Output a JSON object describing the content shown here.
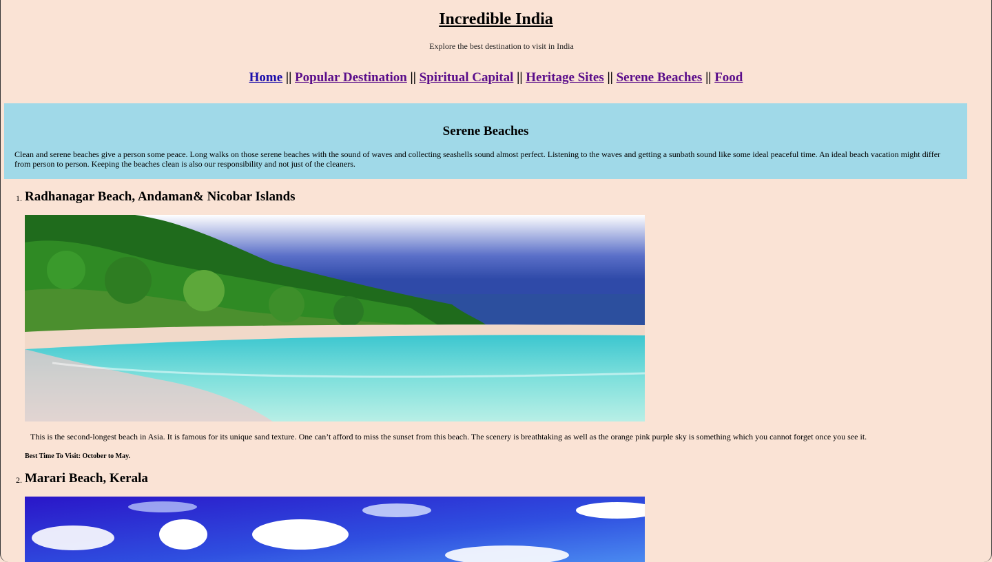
{
  "header": {
    "title": "Incredible India",
    "subtitle": "Explore the best destination to visit in India"
  },
  "nav": {
    "separator": "||",
    "items": [
      {
        "label": "Home"
      },
      {
        "label": "Popular Destination"
      },
      {
        "label": "Spiritual Capital"
      },
      {
        "label": "Heritage Sites"
      },
      {
        "label": "Serene Beaches"
      },
      {
        "label": "Food"
      }
    ]
  },
  "intro": {
    "heading": "Serene Beaches",
    "text": "Clean and serene beaches give a person some peace. Long walks on those serene beaches with the sound of waves and collecting seashells sound almost perfect. Listening to the waves and getting a sunbath sound like some ideal peaceful time. An ideal beach vacation might differ from person to person. Keeping the beaches clean is also our responsibility and not just of the cleaners."
  },
  "beaches": [
    {
      "marker": "1.",
      "name": "Radhanagar Beach, Andaman& Nicobar Islands",
      "description": "This is the second-longest beach in Asia. It is famous for its unique sand texture. One can’t afford to miss the sunset from this beach. The scenery is breathtaking as well as the orange pink purple sky is something which you cannot forget once you see it.",
      "best_time": "Best Time To Visit: October to May."
    },
    {
      "marker": "2.",
      "name": "Marari Beach, Kerala"
    }
  ]
}
